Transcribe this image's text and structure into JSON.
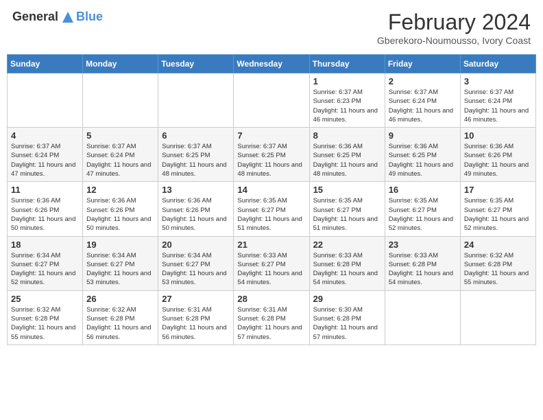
{
  "header": {
    "logo_general": "General",
    "logo_blue": "Blue",
    "month_year": "February 2024",
    "location": "Gberekoro-Noumousso, Ivory Coast"
  },
  "days_of_week": [
    "Sunday",
    "Monday",
    "Tuesday",
    "Wednesday",
    "Thursday",
    "Friday",
    "Saturday"
  ],
  "weeks": [
    {
      "days": [
        {
          "num": "",
          "info": ""
        },
        {
          "num": "",
          "info": ""
        },
        {
          "num": "",
          "info": ""
        },
        {
          "num": "",
          "info": ""
        },
        {
          "num": "1",
          "info": "Sunrise: 6:37 AM\nSunset: 6:23 PM\nDaylight: 11 hours and 46 minutes."
        },
        {
          "num": "2",
          "info": "Sunrise: 6:37 AM\nSunset: 6:24 PM\nDaylight: 11 hours and 46 minutes."
        },
        {
          "num": "3",
          "info": "Sunrise: 6:37 AM\nSunset: 6:24 PM\nDaylight: 11 hours and 46 minutes."
        }
      ]
    },
    {
      "days": [
        {
          "num": "4",
          "info": "Sunrise: 6:37 AM\nSunset: 6:24 PM\nDaylight: 11 hours and 47 minutes."
        },
        {
          "num": "5",
          "info": "Sunrise: 6:37 AM\nSunset: 6:24 PM\nDaylight: 11 hours and 47 minutes."
        },
        {
          "num": "6",
          "info": "Sunrise: 6:37 AM\nSunset: 6:25 PM\nDaylight: 11 hours and 48 minutes."
        },
        {
          "num": "7",
          "info": "Sunrise: 6:37 AM\nSunset: 6:25 PM\nDaylight: 11 hours and 48 minutes."
        },
        {
          "num": "8",
          "info": "Sunrise: 6:36 AM\nSunset: 6:25 PM\nDaylight: 11 hours and 48 minutes."
        },
        {
          "num": "9",
          "info": "Sunrise: 6:36 AM\nSunset: 6:25 PM\nDaylight: 11 hours and 49 minutes."
        },
        {
          "num": "10",
          "info": "Sunrise: 6:36 AM\nSunset: 6:26 PM\nDaylight: 11 hours and 49 minutes."
        }
      ]
    },
    {
      "days": [
        {
          "num": "11",
          "info": "Sunrise: 6:36 AM\nSunset: 6:26 PM\nDaylight: 11 hours and 50 minutes."
        },
        {
          "num": "12",
          "info": "Sunrise: 6:36 AM\nSunset: 6:26 PM\nDaylight: 11 hours and 50 minutes."
        },
        {
          "num": "13",
          "info": "Sunrise: 6:36 AM\nSunset: 6:26 PM\nDaylight: 11 hours and 50 minutes."
        },
        {
          "num": "14",
          "info": "Sunrise: 6:35 AM\nSunset: 6:27 PM\nDaylight: 11 hours and 51 minutes."
        },
        {
          "num": "15",
          "info": "Sunrise: 6:35 AM\nSunset: 6:27 PM\nDaylight: 11 hours and 51 minutes."
        },
        {
          "num": "16",
          "info": "Sunrise: 6:35 AM\nSunset: 6:27 PM\nDaylight: 11 hours and 52 minutes."
        },
        {
          "num": "17",
          "info": "Sunrise: 6:35 AM\nSunset: 6:27 PM\nDaylight: 11 hours and 52 minutes."
        }
      ]
    },
    {
      "days": [
        {
          "num": "18",
          "info": "Sunrise: 6:34 AM\nSunset: 6:27 PM\nDaylight: 11 hours and 52 minutes."
        },
        {
          "num": "19",
          "info": "Sunrise: 6:34 AM\nSunset: 6:27 PM\nDaylight: 11 hours and 53 minutes."
        },
        {
          "num": "20",
          "info": "Sunrise: 6:34 AM\nSunset: 6:27 PM\nDaylight: 11 hours and 53 minutes."
        },
        {
          "num": "21",
          "info": "Sunrise: 6:33 AM\nSunset: 6:27 PM\nDaylight: 11 hours and 54 minutes."
        },
        {
          "num": "22",
          "info": "Sunrise: 6:33 AM\nSunset: 6:28 PM\nDaylight: 11 hours and 54 minutes."
        },
        {
          "num": "23",
          "info": "Sunrise: 6:33 AM\nSunset: 6:28 PM\nDaylight: 11 hours and 54 minutes."
        },
        {
          "num": "24",
          "info": "Sunrise: 6:32 AM\nSunset: 6:28 PM\nDaylight: 11 hours and 55 minutes."
        }
      ]
    },
    {
      "days": [
        {
          "num": "25",
          "info": "Sunrise: 6:32 AM\nSunset: 6:28 PM\nDaylight: 11 hours and 55 minutes."
        },
        {
          "num": "26",
          "info": "Sunrise: 6:32 AM\nSunset: 6:28 PM\nDaylight: 11 hours and 56 minutes."
        },
        {
          "num": "27",
          "info": "Sunrise: 6:31 AM\nSunset: 6:28 PM\nDaylight: 11 hours and 56 minutes."
        },
        {
          "num": "28",
          "info": "Sunrise: 6:31 AM\nSunset: 6:28 PM\nDaylight: 11 hours and 57 minutes."
        },
        {
          "num": "29",
          "info": "Sunrise: 6:30 AM\nSunset: 6:28 PM\nDaylight: 11 hours and 57 minutes."
        },
        {
          "num": "",
          "info": ""
        },
        {
          "num": "",
          "info": ""
        }
      ]
    }
  ]
}
